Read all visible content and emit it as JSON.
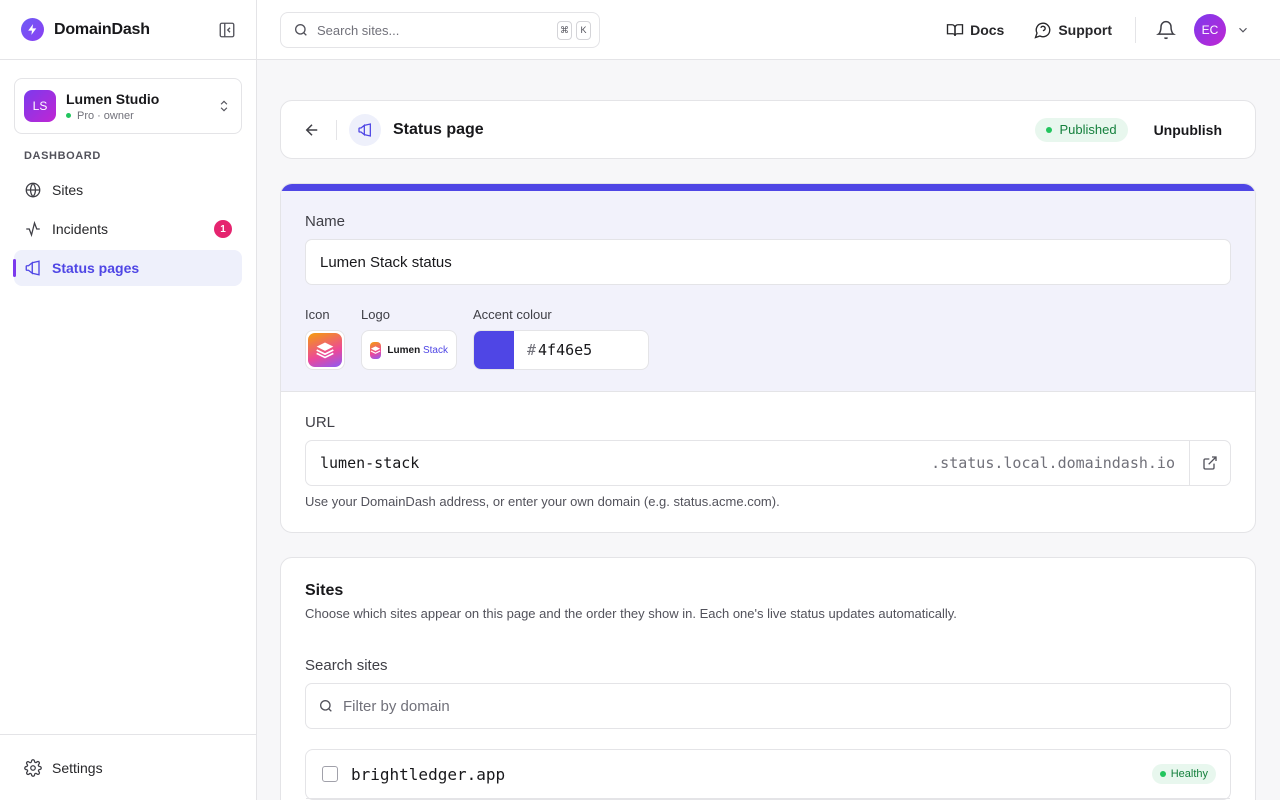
{
  "app": {
    "name": "DomainDash"
  },
  "workspace": {
    "initials": "LS",
    "name": "Lumen Studio",
    "plan": "Pro",
    "sep": "·",
    "role": "owner"
  },
  "nav": {
    "heading": "DASHBOARD",
    "items": [
      {
        "label": "Sites"
      },
      {
        "label": "Incidents",
        "badge": "1"
      },
      {
        "label": "Status pages"
      }
    ],
    "settings_label": "Settings"
  },
  "topbar": {
    "search_placeholder": "Search sites...",
    "shortcut": [
      "⌘",
      "K"
    ],
    "docs_label": "Docs",
    "support_label": "Support",
    "user_initials": "EC"
  },
  "page": {
    "title": "Status page",
    "status_label": "Published",
    "unpublish_label": "Unpublish"
  },
  "form": {
    "accent_color": "#4f46e5",
    "name_label": "Name",
    "name_value": "Lumen Stack status",
    "icon_label": "Icon",
    "logo_label": "Logo",
    "logo_text_1": "Lumen",
    "logo_text_2": "Stack",
    "accent_label": "Accent colour",
    "accent_hash": "#",
    "accent_hex": "4f46e5",
    "url_label": "URL",
    "url_slug": "lumen-stack",
    "url_suffix": ".status.local.domaindash.io",
    "url_help": "Use your DomainDash address, or enter your own domain (e.g. status.acme.com)."
  },
  "sites": {
    "title": "Sites",
    "description": "Choose which sites appear on this page and the order they show in. Each one's live status updates automatically.",
    "search_label": "Search sites",
    "filter_placeholder": "Filter by domain",
    "rows": [
      {
        "domain": "brightledger.app",
        "status": "Healthy"
      }
    ]
  },
  "colors": {
    "brand": "#4f46e5",
    "healthy": "#22c55e",
    "badge": "#e5246f"
  }
}
